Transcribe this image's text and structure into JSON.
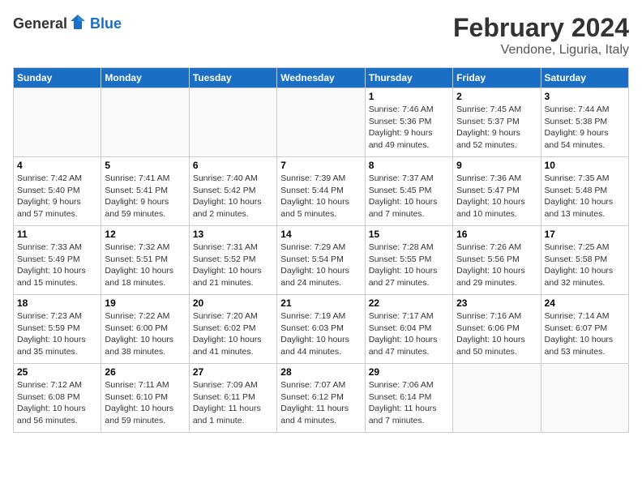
{
  "header": {
    "logo_general": "General",
    "logo_blue": "Blue",
    "month_title": "February 2024",
    "subtitle": "Vendone, Liguria, Italy"
  },
  "weekdays": [
    "Sunday",
    "Monday",
    "Tuesday",
    "Wednesday",
    "Thursday",
    "Friday",
    "Saturday"
  ],
  "weeks": [
    [
      {
        "day": "",
        "info": ""
      },
      {
        "day": "",
        "info": ""
      },
      {
        "day": "",
        "info": ""
      },
      {
        "day": "",
        "info": ""
      },
      {
        "day": "1",
        "info": "Sunrise: 7:46 AM\nSunset: 5:36 PM\nDaylight: 9 hours\nand 49 minutes."
      },
      {
        "day": "2",
        "info": "Sunrise: 7:45 AM\nSunset: 5:37 PM\nDaylight: 9 hours\nand 52 minutes."
      },
      {
        "day": "3",
        "info": "Sunrise: 7:44 AM\nSunset: 5:38 PM\nDaylight: 9 hours\nand 54 minutes."
      }
    ],
    [
      {
        "day": "4",
        "info": "Sunrise: 7:42 AM\nSunset: 5:40 PM\nDaylight: 9 hours\nand 57 minutes."
      },
      {
        "day": "5",
        "info": "Sunrise: 7:41 AM\nSunset: 5:41 PM\nDaylight: 9 hours\nand 59 minutes."
      },
      {
        "day": "6",
        "info": "Sunrise: 7:40 AM\nSunset: 5:42 PM\nDaylight: 10 hours\nand 2 minutes."
      },
      {
        "day": "7",
        "info": "Sunrise: 7:39 AM\nSunset: 5:44 PM\nDaylight: 10 hours\nand 5 minutes."
      },
      {
        "day": "8",
        "info": "Sunrise: 7:37 AM\nSunset: 5:45 PM\nDaylight: 10 hours\nand 7 minutes."
      },
      {
        "day": "9",
        "info": "Sunrise: 7:36 AM\nSunset: 5:47 PM\nDaylight: 10 hours\nand 10 minutes."
      },
      {
        "day": "10",
        "info": "Sunrise: 7:35 AM\nSunset: 5:48 PM\nDaylight: 10 hours\nand 13 minutes."
      }
    ],
    [
      {
        "day": "11",
        "info": "Sunrise: 7:33 AM\nSunset: 5:49 PM\nDaylight: 10 hours\nand 15 minutes."
      },
      {
        "day": "12",
        "info": "Sunrise: 7:32 AM\nSunset: 5:51 PM\nDaylight: 10 hours\nand 18 minutes."
      },
      {
        "day": "13",
        "info": "Sunrise: 7:31 AM\nSunset: 5:52 PM\nDaylight: 10 hours\nand 21 minutes."
      },
      {
        "day": "14",
        "info": "Sunrise: 7:29 AM\nSunset: 5:54 PM\nDaylight: 10 hours\nand 24 minutes."
      },
      {
        "day": "15",
        "info": "Sunrise: 7:28 AM\nSunset: 5:55 PM\nDaylight: 10 hours\nand 27 minutes."
      },
      {
        "day": "16",
        "info": "Sunrise: 7:26 AM\nSunset: 5:56 PM\nDaylight: 10 hours\nand 29 minutes."
      },
      {
        "day": "17",
        "info": "Sunrise: 7:25 AM\nSunset: 5:58 PM\nDaylight: 10 hours\nand 32 minutes."
      }
    ],
    [
      {
        "day": "18",
        "info": "Sunrise: 7:23 AM\nSunset: 5:59 PM\nDaylight: 10 hours\nand 35 minutes."
      },
      {
        "day": "19",
        "info": "Sunrise: 7:22 AM\nSunset: 6:00 PM\nDaylight: 10 hours\nand 38 minutes."
      },
      {
        "day": "20",
        "info": "Sunrise: 7:20 AM\nSunset: 6:02 PM\nDaylight: 10 hours\nand 41 minutes."
      },
      {
        "day": "21",
        "info": "Sunrise: 7:19 AM\nSunset: 6:03 PM\nDaylight: 10 hours\nand 44 minutes."
      },
      {
        "day": "22",
        "info": "Sunrise: 7:17 AM\nSunset: 6:04 PM\nDaylight: 10 hours\nand 47 minutes."
      },
      {
        "day": "23",
        "info": "Sunrise: 7:16 AM\nSunset: 6:06 PM\nDaylight: 10 hours\nand 50 minutes."
      },
      {
        "day": "24",
        "info": "Sunrise: 7:14 AM\nSunset: 6:07 PM\nDaylight: 10 hours\nand 53 minutes."
      }
    ],
    [
      {
        "day": "25",
        "info": "Sunrise: 7:12 AM\nSunset: 6:08 PM\nDaylight: 10 hours\nand 56 minutes."
      },
      {
        "day": "26",
        "info": "Sunrise: 7:11 AM\nSunset: 6:10 PM\nDaylight: 10 hours\nand 59 minutes."
      },
      {
        "day": "27",
        "info": "Sunrise: 7:09 AM\nSunset: 6:11 PM\nDaylight: 11 hours\nand 1 minute."
      },
      {
        "day": "28",
        "info": "Sunrise: 7:07 AM\nSunset: 6:12 PM\nDaylight: 11 hours\nand 4 minutes."
      },
      {
        "day": "29",
        "info": "Sunrise: 7:06 AM\nSunset: 6:14 PM\nDaylight: 11 hours\nand 7 minutes."
      },
      {
        "day": "",
        "info": ""
      },
      {
        "day": "",
        "info": ""
      }
    ]
  ]
}
